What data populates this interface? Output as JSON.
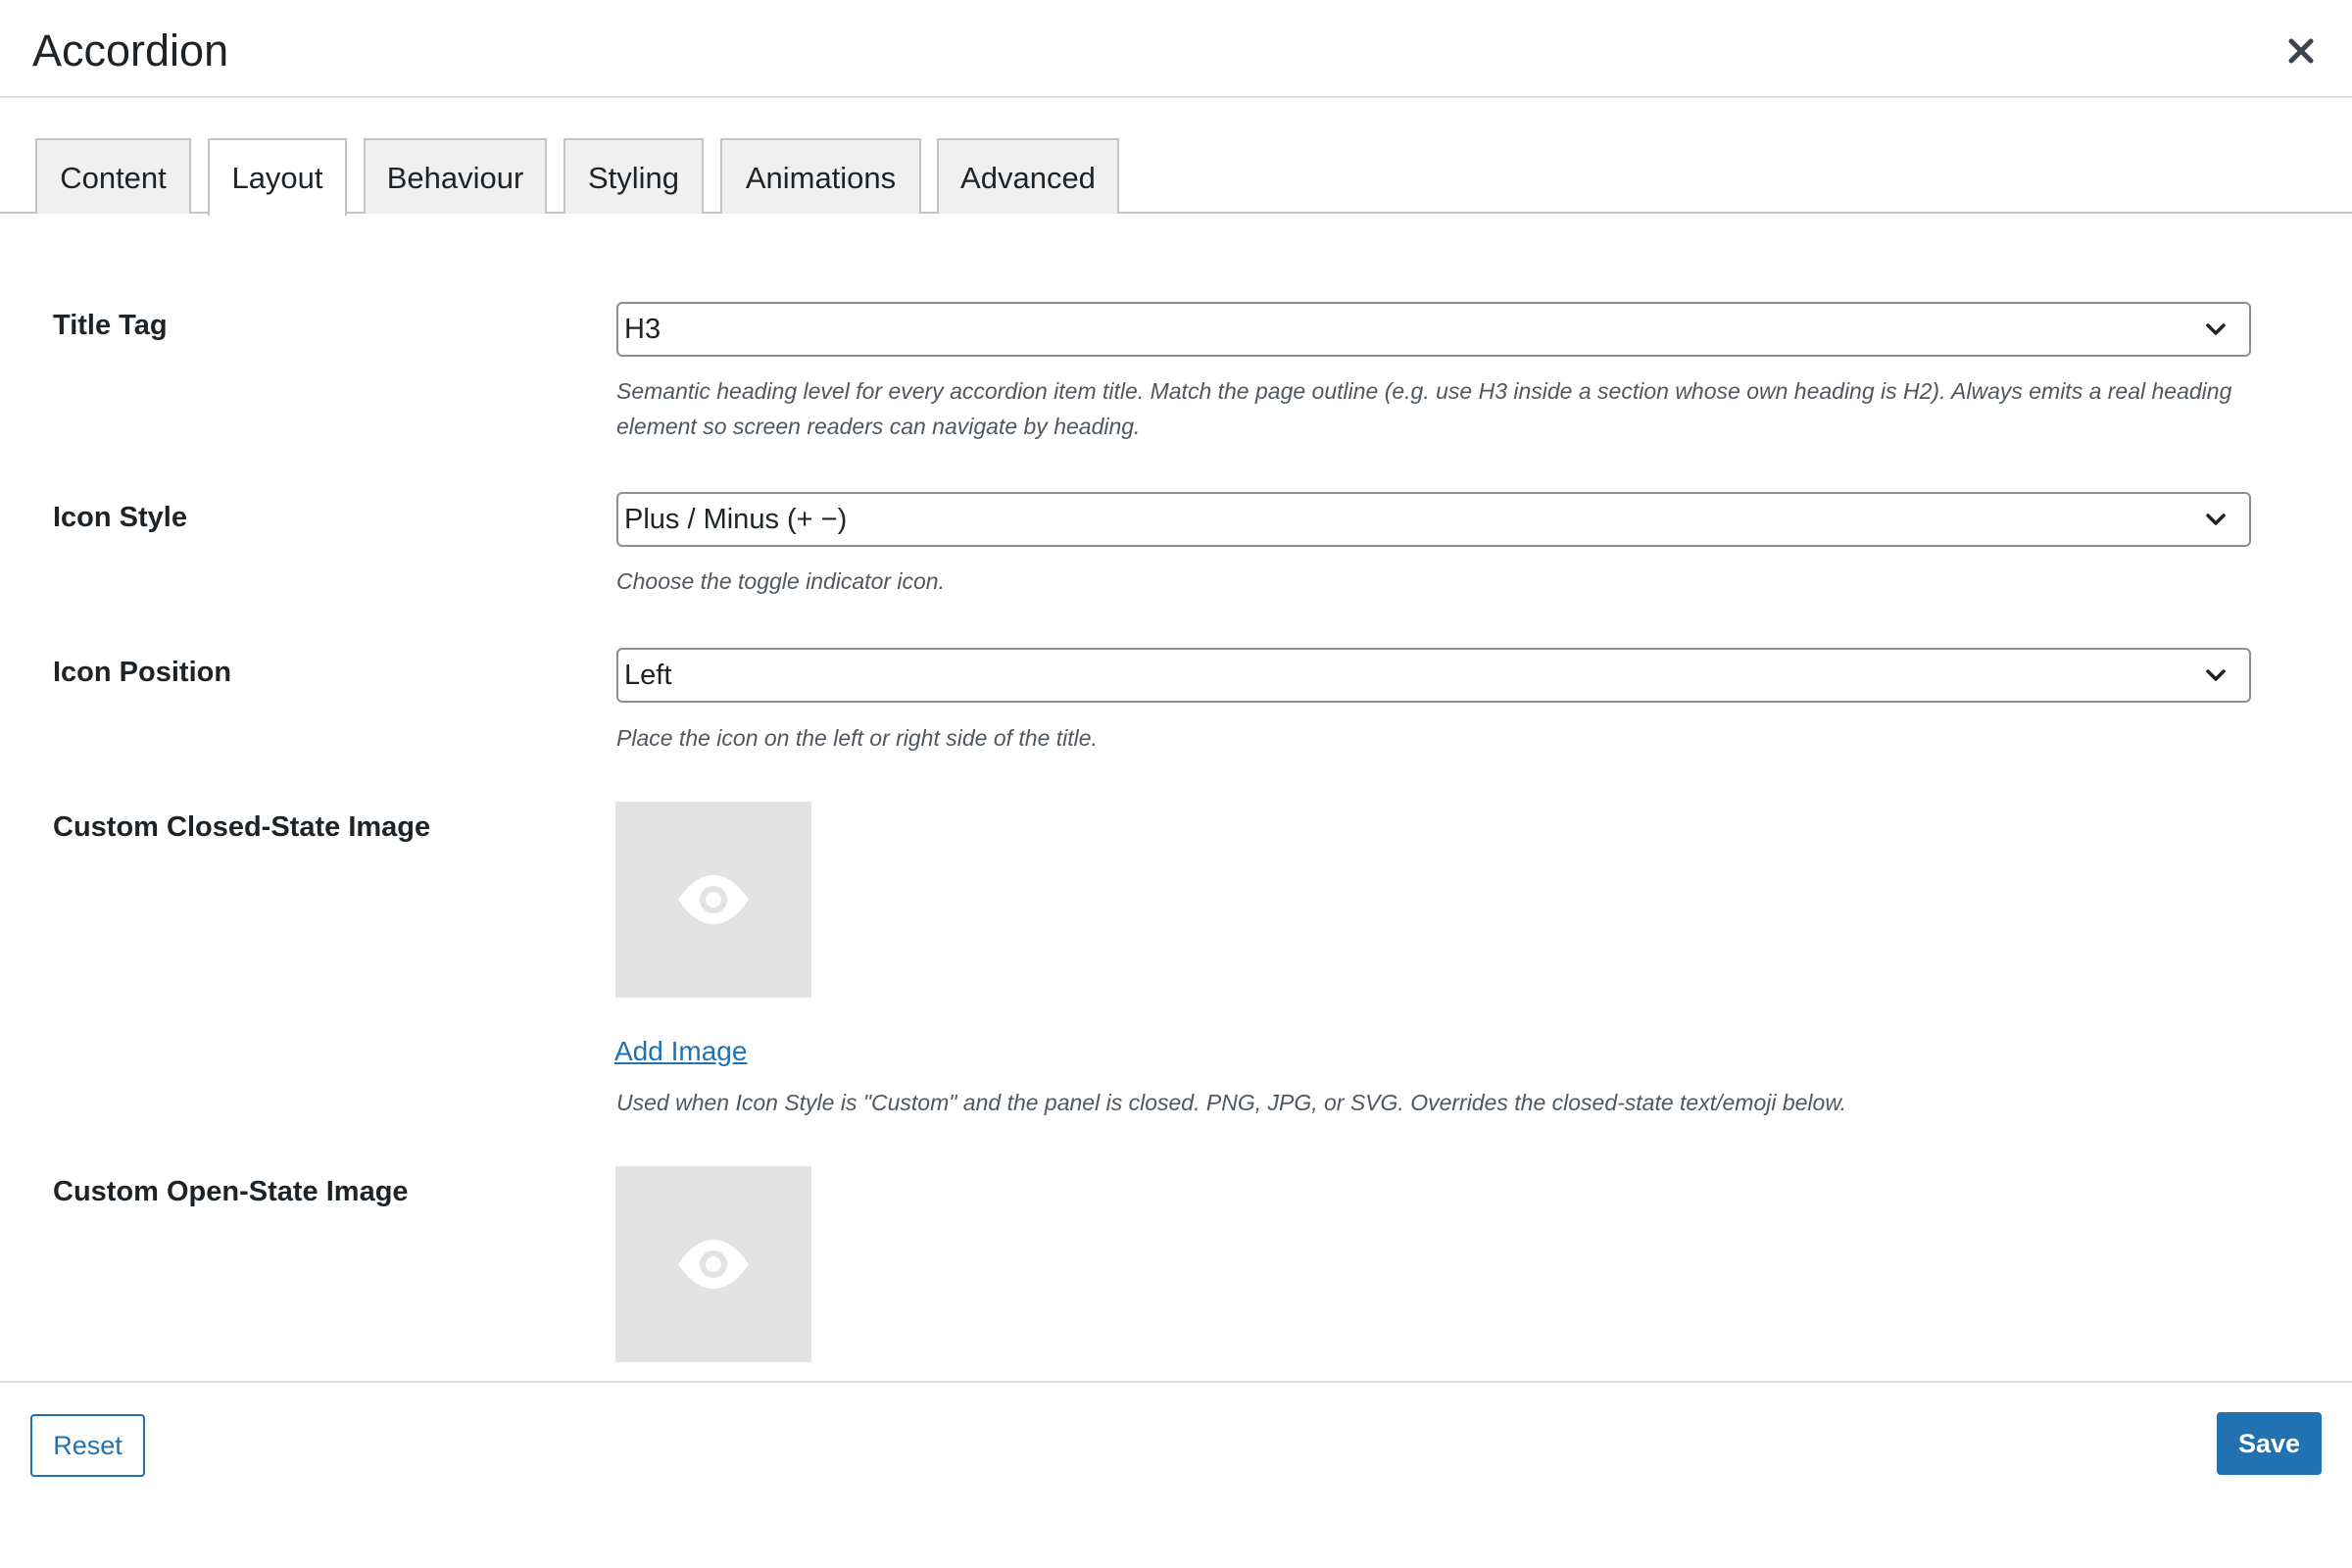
{
  "header": {
    "title": "Accordion",
    "close_icon": "close-icon"
  },
  "tabs": [
    {
      "label": "Content",
      "active": false
    },
    {
      "label": "Layout",
      "active": true
    },
    {
      "label": "Behaviour",
      "active": false
    },
    {
      "label": "Styling",
      "active": false
    },
    {
      "label": "Animations",
      "active": false
    },
    {
      "label": "Advanced",
      "active": false
    }
  ],
  "fields": {
    "title_tag": {
      "label": "Title Tag",
      "value": "H3",
      "description": "Semantic heading level for every accordion item title. Match the page outline (e.g. use H3 inside a section whose own heading is H2). Always emits a real heading element so screen readers can navigate by heading."
    },
    "icon_style": {
      "label": "Icon Style",
      "value": "Plus / Minus (+ −)",
      "description": "Choose the toggle indicator icon."
    },
    "icon_position": {
      "label": "Icon Position",
      "value": "Left",
      "description": "Place the icon on the left or right side of the title."
    },
    "closed_image": {
      "label": "Custom Closed-State Image",
      "link": "Add Image",
      "description": "Used when Icon Style is \"Custom\" and the panel is closed. PNG, JPG, or SVG. Overrides the closed-state text/emoji below.",
      "placeholder_icon": "eye-icon"
    },
    "open_image": {
      "label": "Custom Open-State Image",
      "placeholder_icon": "eye-icon"
    }
  },
  "footer": {
    "reset_label": "Reset",
    "save_label": "Save"
  },
  "colors": {
    "accent": "#2271b1",
    "border": "#c3c4c7",
    "tab_bg": "#f0f0f1",
    "placeholder_bg": "#e2e2e2",
    "muted_text": "#50575e"
  }
}
